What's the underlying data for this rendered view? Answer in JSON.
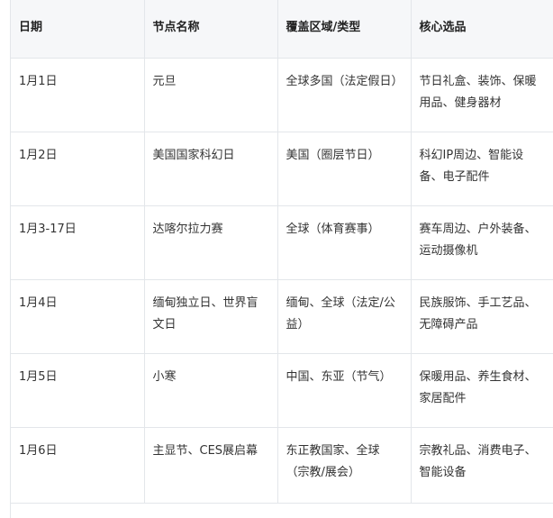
{
  "table": {
    "headers": [
      "日期",
      "节点名称",
      "覆盖区域/类型",
      "核心选品"
    ],
    "rows": [
      [
        "1月1日",
        "元旦",
        "全球多国（法定假日）",
        "节日礼盒、装饰、保暖用品、健身器材"
      ],
      [
        "1月2日",
        "美国国家科幻日",
        "美国（圈层节日）",
        "科幻IP周边、智能设备、电子配件"
      ],
      [
        "1月3-17日",
        "达喀尔拉力赛",
        "全球（体育赛事）",
        "赛车周边、户外装备、运动摄像机"
      ],
      [
        "1月4日",
        "缅甸独立日、世界盲文日",
        "缅甸、全球（法定/公益）",
        "民族服饰、手工艺品、无障碍产品"
      ],
      [
        "1月5日",
        "小寒",
        "中国、东亚（节气）",
        "保暖用品、养生食材、家居配件"
      ],
      [
        "1月6日",
        "主显节、CES展启幕",
        "东正教国家、全球（宗教/展会）",
        "宗教礼品、消费电子、智能设备"
      ]
    ]
  }
}
